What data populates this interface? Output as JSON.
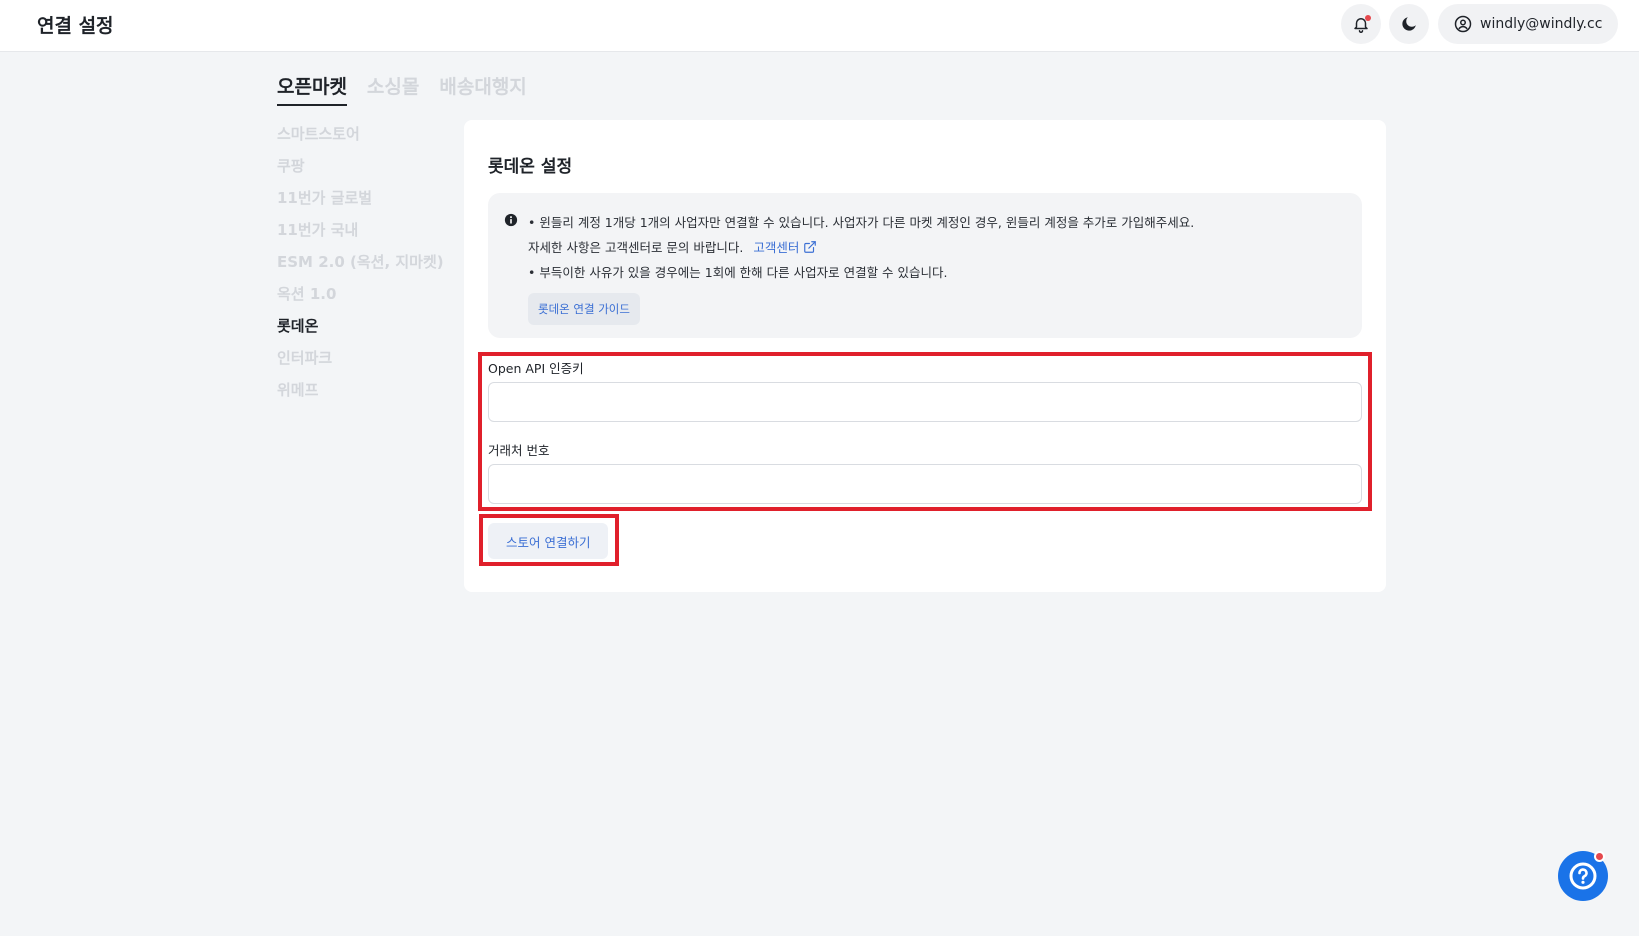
{
  "header": {
    "title": "연결 설정",
    "user_email": "windly@windly.cc",
    "icons": [
      "bell-icon",
      "moon-icon",
      "user-circle-icon"
    ]
  },
  "tabs": [
    {
      "label": "오픈마켓",
      "active": true
    },
    {
      "label": "소싱몰",
      "active": false
    },
    {
      "label": "배송대행지",
      "active": false
    }
  ],
  "sidebar": {
    "items": [
      {
        "label": "스마트스토어",
        "active": false
      },
      {
        "label": "쿠팡",
        "active": false
      },
      {
        "label": "11번가 글로벌",
        "active": false
      },
      {
        "label": "11번가 국내",
        "active": false
      },
      {
        "label": "ESM 2.0 (옥션, 지마켓)",
        "active": false
      },
      {
        "label": "옥션 1.0",
        "active": false
      },
      {
        "label": "롯데온",
        "active": true
      },
      {
        "label": "인터파크",
        "active": false
      },
      {
        "label": "위메프",
        "active": false
      }
    ]
  },
  "settings": {
    "title": "롯데온 설정",
    "notice": {
      "line1": "• 윈들리 계정 1개당 1개의 사업자만 연결할 수 있습니다. 사업자가 다른 마켓 계정인 경우, 윈들리 계정을 추가로 가입해주세요.",
      "line2": "자세한 사항은 고객센터로 문의 바랍니다.",
      "link_label": "고객센터",
      "line3": "• 부득이한 사유가 있을 경우에는 1회에 한해 다른 사업자로 연결할 수 있습니다.",
      "guide_button": "롯데온 연결 가이드"
    },
    "fields": {
      "api_key_label": "Open API 인증키",
      "api_key_value": "",
      "vendor_label": "거래처 번호",
      "vendor_value": ""
    },
    "connect_button": "스토어 연결하기"
  },
  "colors": {
    "accent": "#3b6fd4",
    "highlight": "#e0202b",
    "fab": "#1a73e8"
  }
}
